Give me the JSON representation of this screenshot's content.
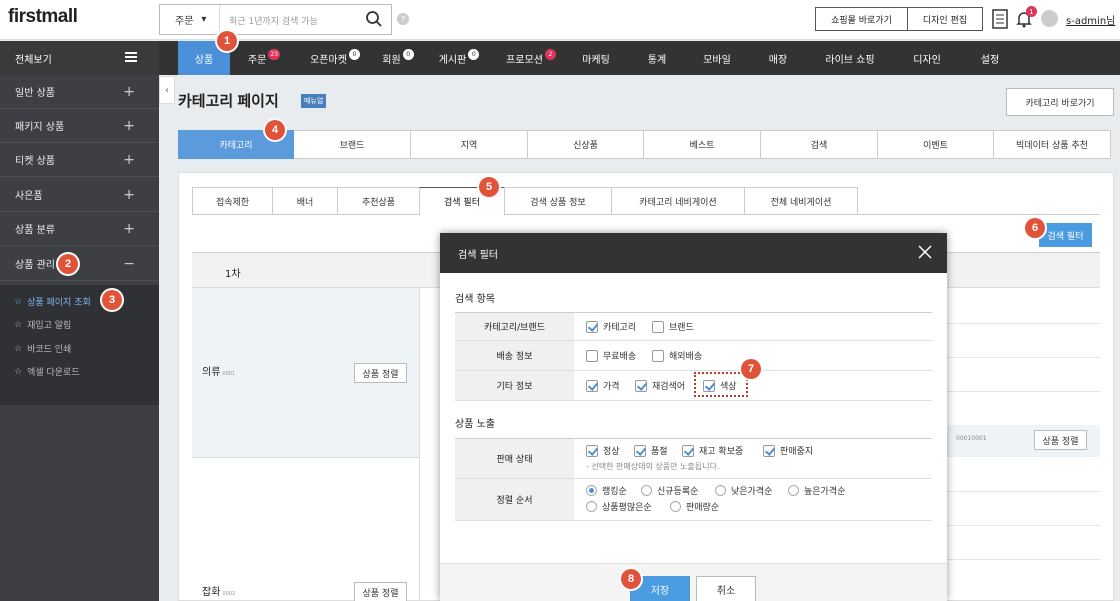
{
  "header": {
    "logo": "firstmall",
    "search_select": "주문",
    "search_placeholder": "최근 1년까지 검색 가능",
    "help": "?",
    "shop_btn": "쇼핑몰 바로가기",
    "design_btn": "디자인 편집",
    "alert_count": "1",
    "user": "s-admin님"
  },
  "nav": {
    "all": "전체보기",
    "items": [
      {
        "label": "상품",
        "badge": ""
      },
      {
        "label": "주문",
        "badge": "23"
      },
      {
        "label": "오픈마켓",
        "badge": "0"
      },
      {
        "label": "회원",
        "badge": "0"
      },
      {
        "label": "게시판",
        "badge": "0"
      },
      {
        "label": "프로모션",
        "badge": "2"
      },
      {
        "label": "마케팅",
        "badge": ""
      },
      {
        "label": "통계",
        "badge": ""
      },
      {
        "label": "모바일",
        "badge": ""
      },
      {
        "label": "매장",
        "badge": ""
      },
      {
        "label": "라이브 쇼핑",
        "badge": ""
      },
      {
        "label": "디자인",
        "badge": ""
      },
      {
        "label": "설정",
        "badge": ""
      }
    ]
  },
  "sidebar": {
    "items": [
      "일반 상품",
      "패키지 상품",
      "티켓 상품",
      "사은품",
      "상품 분류",
      "상품 관리"
    ],
    "sub": [
      "상품 페이지 조회",
      "재입고 알림",
      "바코드 인쇄",
      "엑셀 다운로드"
    ]
  },
  "page": {
    "title": "카테고리 페이지",
    "manual": "매뉴얼",
    "goto": "카테고리 바로가기"
  },
  "cat_tabs": [
    "카테고리",
    "브랜드",
    "지역",
    "신상품",
    "베스트",
    "검색",
    "이벤트",
    "빅데이터 상품 추천"
  ],
  "sub_tabs": [
    "접속제한",
    "배너",
    "추천상품",
    "검색 필터",
    "검색 상품 정보",
    "카테고리 네비게이션",
    "전체 네비게이션"
  ],
  "search_filter_btn": "검색 필터",
  "table": {
    "col1": "1차",
    "rows": [
      {
        "name": "의류",
        "code": "0001",
        "btn": "상품 정렬"
      },
      {
        "name": "잡화",
        "code": "0002",
        "btn": "상품 정렬"
      }
    ],
    "right_code": "00010001",
    "right_btn": "상품 정렬"
  },
  "modal": {
    "title": "검색 필터",
    "sec1": "검색 항목",
    "rows1": [
      {
        "label": "카테고리/브랜드",
        "opts": [
          {
            "t": "카테고리",
            "on": true
          },
          {
            "t": "브랜드",
            "on": false
          }
        ]
      },
      {
        "label": "배송 정보",
        "opts": [
          {
            "t": "무료배송",
            "on": false
          },
          {
            "t": "해외배송",
            "on": false
          }
        ]
      },
      {
        "label": "기타 정보",
        "opts": [
          {
            "t": "가격",
            "on": true
          },
          {
            "t": "재검색어",
            "on": true
          },
          {
            "t": "색상",
            "on": true
          }
        ]
      }
    ],
    "sec2": "상품 노출",
    "status_label": "판매 상태",
    "status_opts": [
      {
        "t": "정상",
        "on": true
      },
      {
        "t": "품절",
        "on": true
      },
      {
        "t": "재고 확보중",
        "on": true
      },
      {
        "t": "판매중지",
        "on": true
      }
    ],
    "status_note": "- 선택한 판매상태의 상품만 노출됩니다.",
    "sort_label": "정렬 순서",
    "sort_opts": [
      {
        "t": "랭킹순",
        "on": true
      },
      {
        "t": "신규등록순",
        "on": false
      },
      {
        "t": "낮은가격순",
        "on": false
      },
      {
        "t": "높은가격순",
        "on": false
      },
      {
        "t": "상품평많은순",
        "on": false
      },
      {
        "t": "판매량순",
        "on": false
      }
    ],
    "save": "저장",
    "cancel": "취소"
  },
  "steps": [
    "1",
    "2",
    "3",
    "4",
    "5",
    "6",
    "7",
    "8"
  ]
}
